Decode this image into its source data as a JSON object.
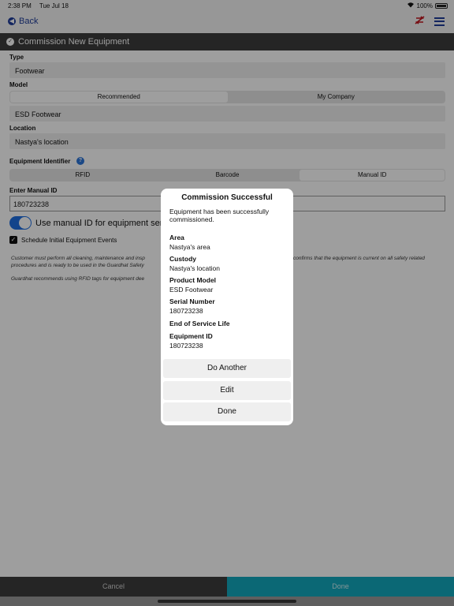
{
  "status_bar": {
    "time": "2:38 PM",
    "date": "Tue Jul 18",
    "battery": "100%"
  },
  "nav": {
    "back_label": "Back"
  },
  "header": {
    "title": "Commission New Equipment"
  },
  "form": {
    "type_label": "Type",
    "type_value": "Footwear",
    "model_label": "Model",
    "model_segments": [
      "Recommended",
      "My Company"
    ],
    "model_selected": "Recommended",
    "model_value": "ESD Footwear",
    "location_label": "Location",
    "location_value": "Nastya's location",
    "identifier_label": "Equipment Identifier",
    "identifier_segments": [
      "RFID",
      "Barcode",
      "Manual ID"
    ],
    "identifier_selected": "Manual ID",
    "manual_id_label": "Enter Manual ID",
    "manual_id_value": "180723238",
    "toggle_label": "Use manual ID for equipment serial",
    "toggle_on": true,
    "schedule_label": "Schedule Initial Equipment Events",
    "schedule_checked": true,
    "disclaimer_1a": "Customer must perform all cleaning, maintenance and insp",
    "disclaimer_1b": "confirms that the equipment is current on all safety related",
    "disclaimer_2": "procedures and is ready to be used in the Guardhat Safety",
    "disclaimer_3": "Guardhat recommends using RFID tags for equipment dee"
  },
  "modal": {
    "title": "Commission Successful",
    "message": "Equipment has been successfully commissioned.",
    "fields": [
      {
        "label": "Area",
        "value": "Nastya's area"
      },
      {
        "label": "Custody",
        "value": "Nastya's location"
      },
      {
        "label": "Product Model",
        "value": "ESD Footwear"
      },
      {
        "label": "Serial Number",
        "value": "180723238"
      },
      {
        "label": "End of Service Life",
        "value": ""
      },
      {
        "label": "Equipment ID",
        "value": "180723238"
      }
    ],
    "buttons": {
      "do_another": "Do Another",
      "edit": "Edit",
      "done": "Done"
    }
  },
  "footer": {
    "cancel_label": "Cancel",
    "done_label": "Done"
  },
  "colors": {
    "accent_blue": "#1f3c99",
    "done_teal": "#13a9bd",
    "header_dark": "#3c3c3c",
    "sync_red": "#c0121b"
  }
}
